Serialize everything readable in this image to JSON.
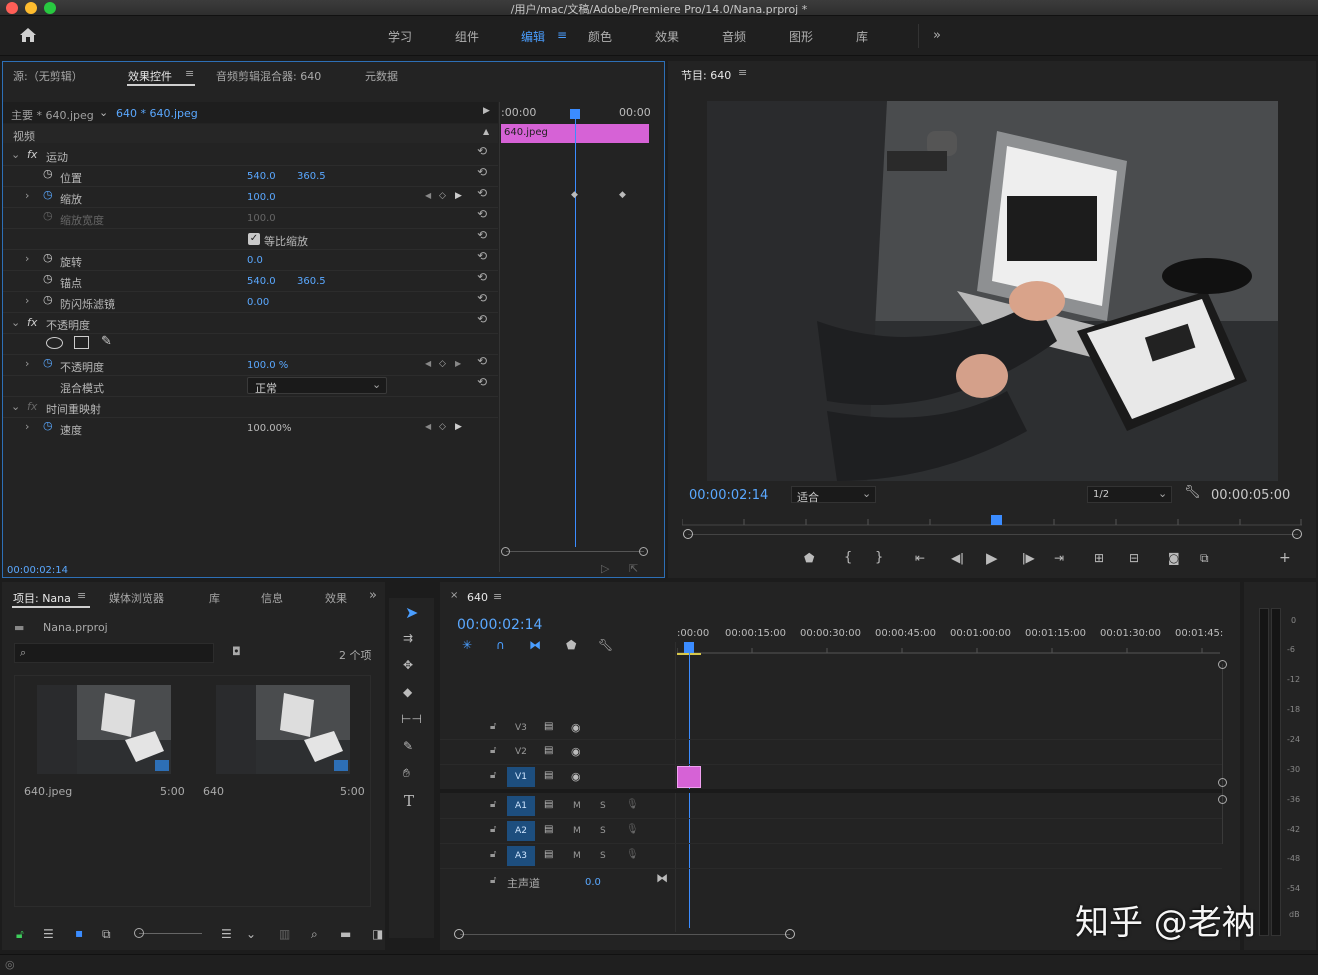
{
  "window": {
    "title": "/用户/mac/文稿/Adobe/Premiere Pro/14.0/Nana.prproj *"
  },
  "workspaces": [
    {
      "label": "学习"
    },
    {
      "label": "组件"
    },
    {
      "label": "编辑"
    },
    {
      "label": "颜色"
    },
    {
      "label": "效果"
    },
    {
      "label": "音频"
    },
    {
      "label": "图形"
    },
    {
      "label": "库"
    }
  ],
  "source_panel": {
    "tabs": [
      "源:（无剪辑）",
      "效果控件",
      "音频剪辑混合器: 640",
      "元数据"
    ],
    "master": "主要 * 640.jpeg",
    "clip": "640 * 640.jpeg",
    "video_label": "视频",
    "timecode_start": ":00:00",
    "timecode_end": "00:00",
    "clip_name": "640.jpeg",
    "current_time": "00:00:02:14",
    "rows": [
      {
        "name": "运动",
        "v1": "",
        "v2": ""
      },
      {
        "name": "位置",
        "v1": "540.0",
        "v2": "360.5"
      },
      {
        "name": "缩放",
        "v1": "100.0",
        "v2": ""
      },
      {
        "name": "缩放宽度",
        "v1": "100.0",
        "v2": ""
      },
      {
        "name": "等比缩放",
        "v1": "",
        "v2": ""
      },
      {
        "name": "旋转",
        "v1": "0.0",
        "v2": ""
      },
      {
        "name": "锚点",
        "v1": "540.0",
        "v2": "360.5"
      },
      {
        "name": "防闪烁滤镜",
        "v1": "0.00",
        "v2": ""
      },
      {
        "name": "不透明度",
        "v1": "",
        "v2": ""
      },
      {
        "name": "",
        "v1": "",
        "v2": ""
      },
      {
        "name": "不透明度",
        "v1": "100.0 %",
        "v2": ""
      },
      {
        "name": "混合模式",
        "v1": "正常",
        "v2": ""
      },
      {
        "name": "时间重映射",
        "v1": "",
        "v2": ""
      },
      {
        "name": "速度",
        "v1": "100.00%",
        "v2": ""
      }
    ],
    "fx_label": "fx"
  },
  "program": {
    "title": "节目: 640",
    "timecode": "00:00:02:14",
    "fit": "适合",
    "resolution": "1/2",
    "duration": "00:00:05:00"
  },
  "project": {
    "tabs": [
      "项目: Nana",
      "媒体浏览器",
      "库",
      "信息",
      "效果"
    ],
    "file": "Nana.prproj",
    "count": "2 个项",
    "items": [
      {
        "name": "640.jpeg",
        "duration": "5:00"
      },
      {
        "name": "640",
        "duration": "5:00"
      }
    ]
  },
  "timeline": {
    "tab": "640",
    "timecode": "00:00:02:14",
    "ruler": [
      ":00:00",
      "00:00:15:00",
      "00:00:30:00",
      "00:00:45:00",
      "00:01:00:00",
      "00:01:15:00",
      "00:01:30:00",
      "00:01:45:"
    ],
    "video_tracks": [
      "V3",
      "V2",
      "V1"
    ],
    "audio_tracks": [
      "A1",
      "A2",
      "A3"
    ],
    "master_label": "主声道",
    "master_value": "0.0",
    "m": "M",
    "s": "S"
  },
  "meter": {
    "ticks": [
      "0",
      "-6",
      "-12",
      "-18",
      "-24",
      "-30",
      "-36",
      "-42",
      "-48",
      "-54",
      "dB"
    ]
  },
  "watermark": "知乎 @老衲"
}
